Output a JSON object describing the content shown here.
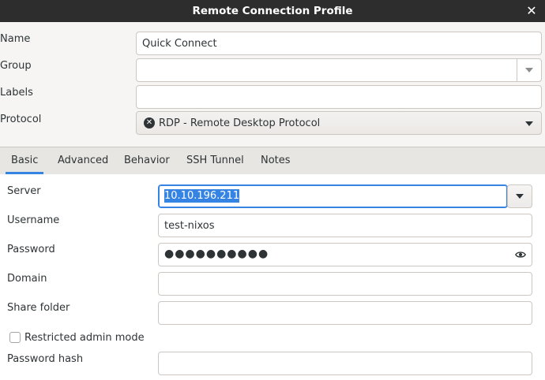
{
  "window": {
    "title": "Remote Connection Profile"
  },
  "profile": {
    "name_label": "Name",
    "name_value": "Quick Connect",
    "group_label": "Group",
    "group_value": "",
    "labels_label": "Labels",
    "labels_value": "",
    "protocol_label": "Protocol",
    "protocol_value": "RDP - Remote Desktop Protocol"
  },
  "tabs": [
    {
      "label": "Basic",
      "active": true
    },
    {
      "label": "Advanced"
    },
    {
      "label": "Behavior"
    },
    {
      "label": "SSH Tunnel"
    },
    {
      "label": "Notes"
    }
  ],
  "basic": {
    "server_label": "Server",
    "server_value": "10.10.196.211",
    "username_label": "Username",
    "username_value": "test-nixos",
    "password_label": "Password",
    "password_dots": "●●●●●●●●●●",
    "domain_label": "Domain",
    "domain_value": "",
    "share_label": "Share folder",
    "share_value": "",
    "restricted_label": "Restricted admin mode",
    "hash_label": "Password hash",
    "hash_value": ""
  },
  "colors": {
    "accent": "#3584e4",
    "titlebar": "#2d2d2d"
  }
}
